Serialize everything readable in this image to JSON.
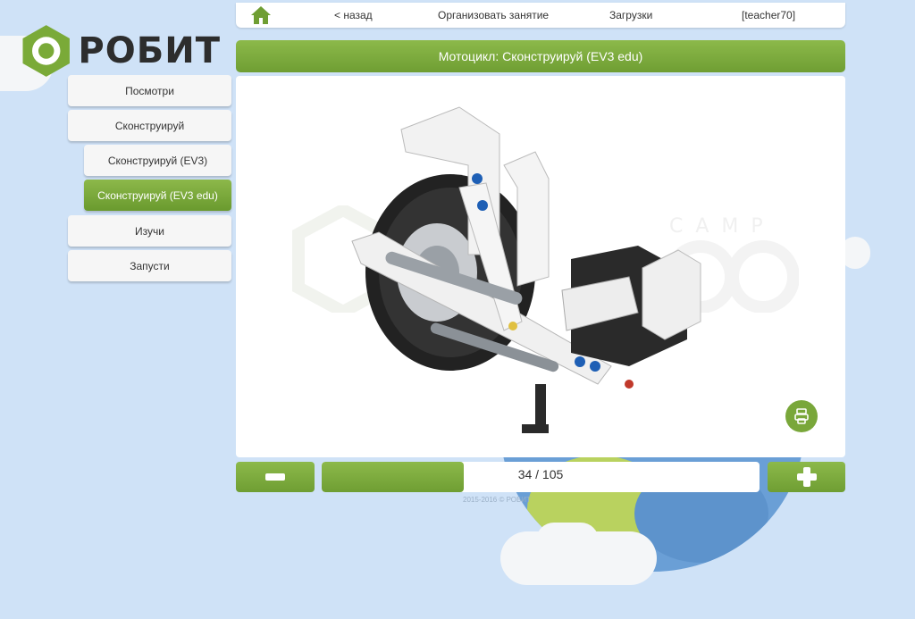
{
  "brand": {
    "name": "РОБИТ",
    "green": "#7aaa38",
    "dark": "#2d2d2d",
    "watermark_text": "CAMP"
  },
  "topnav": {
    "home_icon": "home-icon",
    "back": "< назад",
    "organize": "Организовать занятие",
    "downloads": "Загрузки",
    "user": "[teacher70]"
  },
  "sidebar": {
    "items": [
      {
        "label": "Посмотри"
      },
      {
        "label": "Сконструируй"
      },
      {
        "label": "Сконструируй (EV3)"
      },
      {
        "label": "Сконструируй (EV3 edu)",
        "active": true
      },
      {
        "label": "Изучи"
      },
      {
        "label": "Запусти"
      }
    ]
  },
  "main": {
    "title": "Мотоцикл: Сконструируй (EV3 edu)",
    "print_icon": "print-icon"
  },
  "pager": {
    "current": 34,
    "total": 105,
    "label": "34 / 105",
    "minus_icon": "minus-icon",
    "plus_icon": "plus-icon"
  },
  "footer": {
    "copyright": "2015-2016 © РОБИТ"
  }
}
